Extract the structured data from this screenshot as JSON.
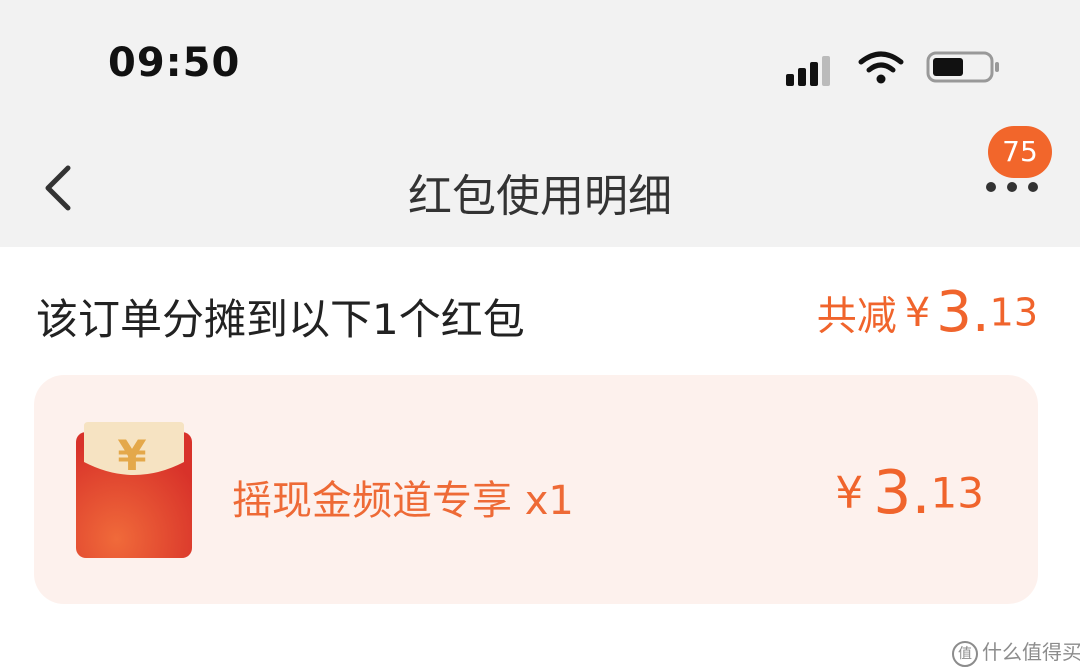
{
  "status_bar": {
    "time": "09:50",
    "icons": [
      "signal-icon",
      "wifi-icon",
      "battery-icon"
    ]
  },
  "nav": {
    "back_icon": "chevron-left-icon",
    "title": "红包使用明细",
    "more_icon": "more-dots-icon",
    "badge_count": "75"
  },
  "summary": {
    "text": "该订单分摊到以下1个红包",
    "reduce_label": "共减",
    "currency": "¥",
    "amount_int": "3.",
    "amount_dec": "13"
  },
  "packet": {
    "icon": "red-envelope-icon",
    "name": "摇现金频道专享 x1",
    "currency": "¥",
    "amount_int": "3.",
    "amount_dec": "13"
  },
  "watermark": {
    "text": "什么值得买",
    "icon": "zhi-icon",
    "icon_glyph": "值"
  },
  "colors": {
    "accent": "#f0642c",
    "header_bg": "#f2f2f2",
    "card_bg": "#fdf1ed",
    "badge": "#f2662b"
  }
}
